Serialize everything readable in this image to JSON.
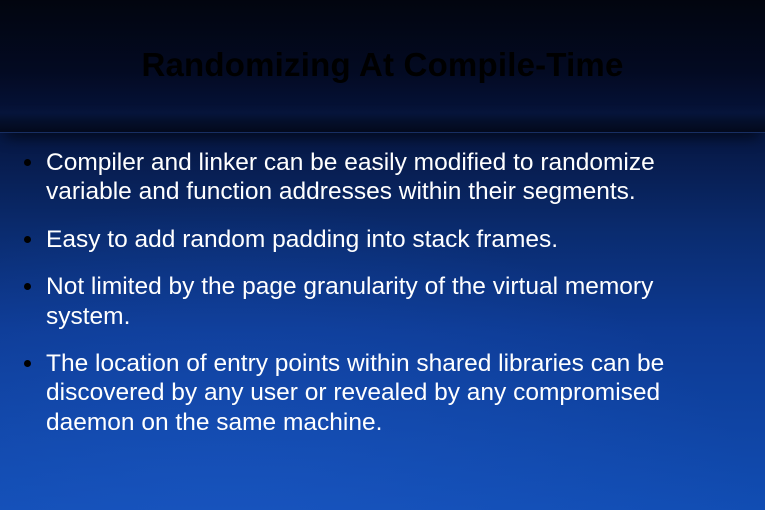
{
  "slide": {
    "title": "Randomizing At Compile-Time",
    "bullets": [
      "Compiler and linker can be easily modified to randomize variable and function addresses within their segments.",
      "Easy to add random padding into stack frames.",
      "Not limited by the page granularity of the virtual memory system.",
      "The location of entry points within shared libraries can be discovered by any user or revealed by any compromised daemon on the same machine."
    ]
  }
}
